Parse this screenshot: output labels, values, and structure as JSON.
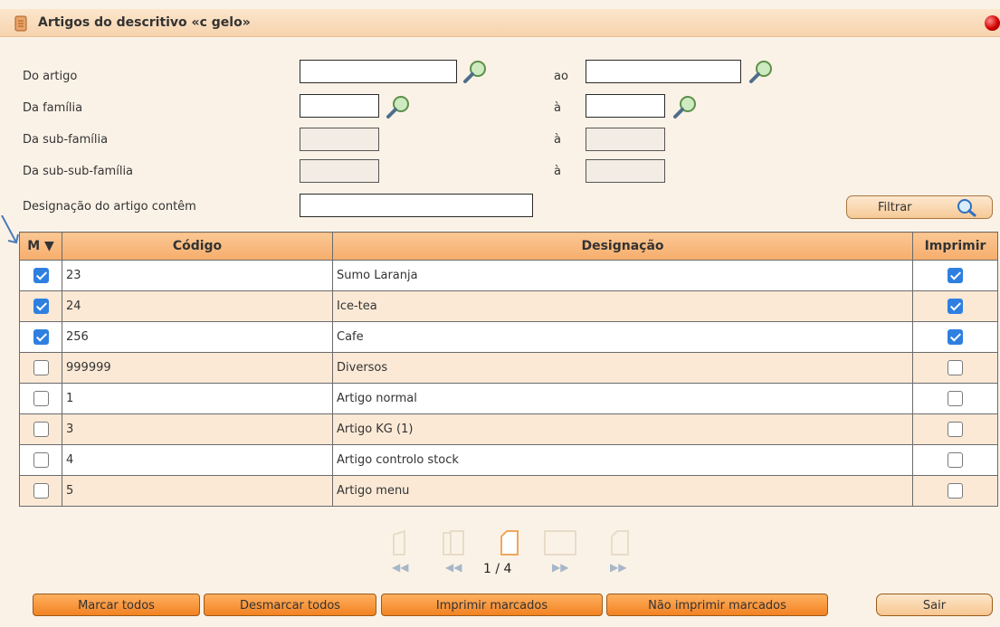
{
  "window": {
    "title": "Artigos do descritivo «c gelo»"
  },
  "filters": {
    "do_artigo_label": "Do artigo",
    "ao_label": "ao",
    "da_familia_label": "Da família",
    "a_label_1": "à",
    "da_subfamilia_label": "Da sub-família",
    "a_label_2": "à",
    "da_subsubfamilia_label": "Da sub-sub-família",
    "a_label_3": "à",
    "designacao_label": "Designação do artigo contêm",
    "do_artigo_value": "",
    "ao_value": "",
    "da_familia_value": "",
    "a_familia_value": "",
    "designacao_value": "",
    "filter_button": "Filtrar"
  },
  "table": {
    "columns": {
      "mark": "M",
      "codigo": "Código",
      "designacao": "Designação",
      "imprimir": "Imprimir"
    },
    "rows": [
      {
        "checked": true,
        "codigo": "23",
        "designacao": "Sumo Laranja",
        "imprimir": true
      },
      {
        "checked": true,
        "codigo": "24",
        "designacao": "Ice-tea",
        "imprimir": true
      },
      {
        "checked": true,
        "codigo": "256",
        "designacao": "Cafe",
        "imprimir": true
      },
      {
        "checked": false,
        "codigo": "999999",
        "designacao": "Diversos",
        "imprimir": false
      },
      {
        "checked": false,
        "codigo": "1",
        "designacao": "Artigo normal",
        "imprimir": false
      },
      {
        "checked": false,
        "codigo": "3",
        "designacao": "Artigo KG (1)",
        "imprimir": false
      },
      {
        "checked": false,
        "codigo": "4",
        "designacao": "Artigo controlo stock",
        "imprimir": false
      },
      {
        "checked": false,
        "codigo": "5",
        "designacao": "Artigo menu",
        "imprimir": false
      }
    ]
  },
  "pagination": {
    "current": "1 / 4"
  },
  "buttons": {
    "marcar_todos": "Marcar todos",
    "desmarcar_todos": "Desmarcar todos",
    "imprimir_marcados": "Imprimir marcados",
    "nao_imprimir_marcados": "Não imprimir marcados",
    "sair": "Sair"
  },
  "colors": {
    "header": "#f6ad6c",
    "accent_button": "#f28221",
    "row_alt": "#fbe9d6",
    "checkbox_on": "#2f7fe0"
  }
}
